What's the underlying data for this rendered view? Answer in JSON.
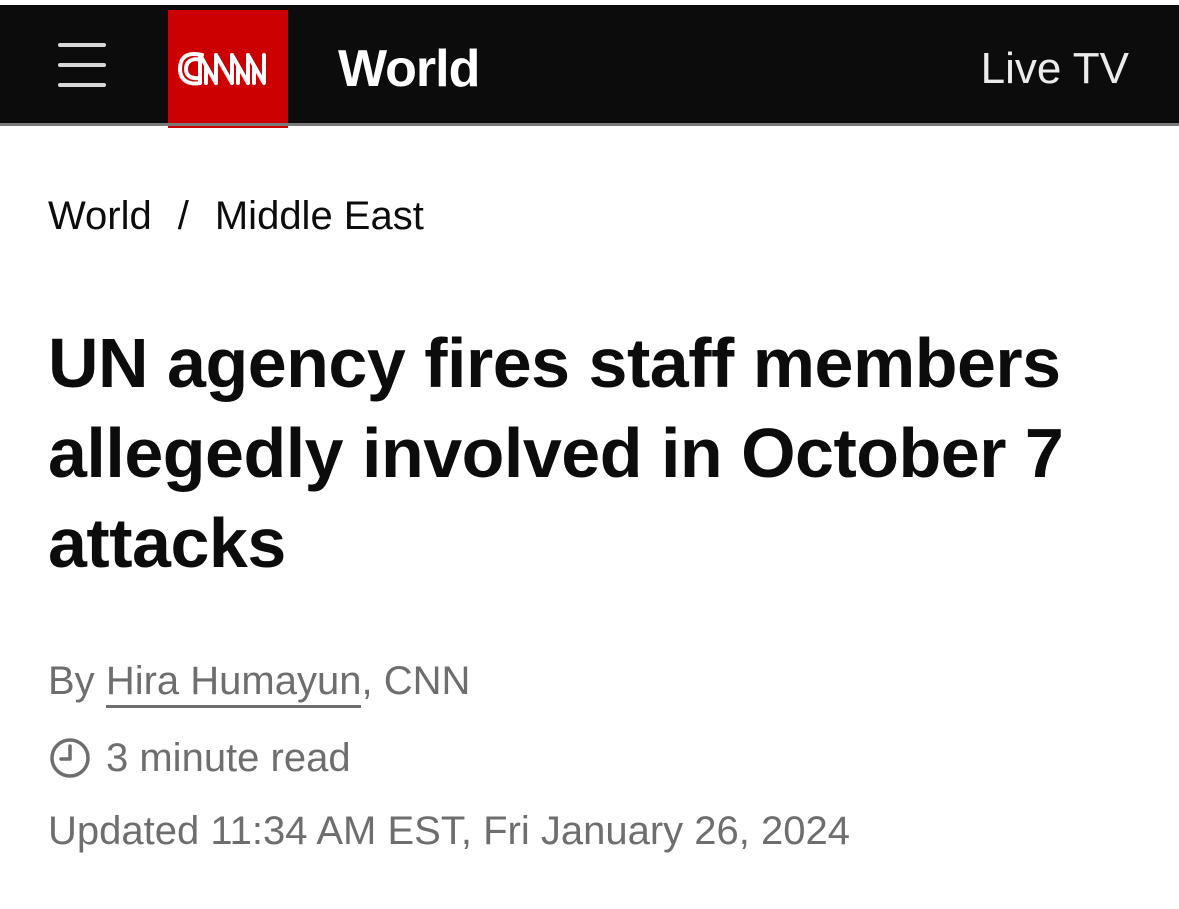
{
  "header": {
    "brand_logo_text": "CNN",
    "section": "World",
    "live_tv": "Live TV",
    "brand_color": "#cc0000",
    "background_color": "#0c0c0c",
    "icons": {
      "menu": "hamburger-menu-icon",
      "logo": "cnn-logo"
    }
  },
  "breadcrumb": {
    "items": [
      "World",
      "Middle East"
    ],
    "separator": "/"
  },
  "article": {
    "headline": "UN agency fires staff members allegedly involved in October 7 attacks",
    "byline": {
      "prefix": "By",
      "author": "Hira Humayun",
      "suffix": ", CNN"
    },
    "read_time": "3 minute read",
    "read_time_icon": "clock-icon",
    "updated": "Updated 11:34 AM EST, Fri January 26, 2024"
  }
}
